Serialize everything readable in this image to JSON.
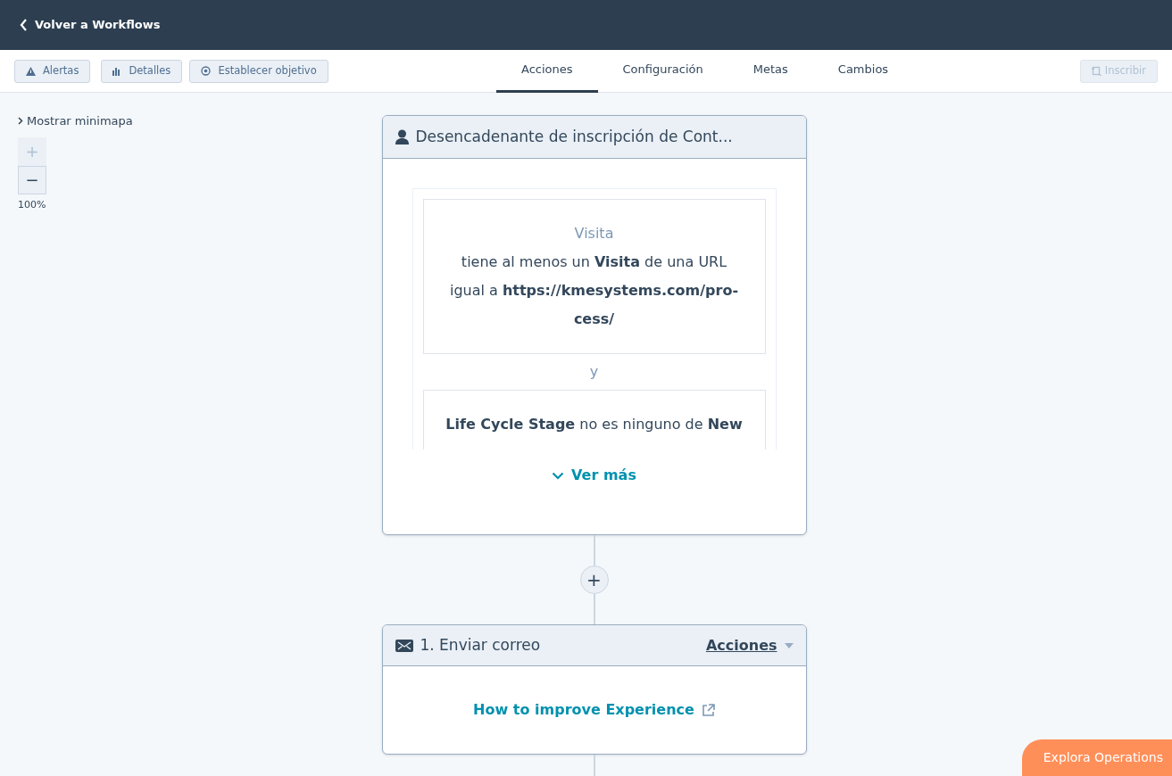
{
  "top_bar": {
    "back_label": "Volver a Workflows"
  },
  "toolbar": {
    "buttons": [
      {
        "label": "Alertas",
        "kind": "alert"
      },
      {
        "label": "Detalles",
        "kind": "chart"
      },
      {
        "label": "Establecer objetivo",
        "kind": "target"
      }
    ]
  },
  "tabs": [
    {
      "label": "Acciones",
      "selected": true
    },
    {
      "label": "Configuración",
      "selected": false
    },
    {
      "label": "Metas",
      "selected": false
    },
    {
      "label": "Cambios",
      "selected": false
    }
  ],
  "enroll_button": {
    "label": "Inscribir",
    "disabled": true
  },
  "canvas": {
    "minimap_toggle": "Mostrar minimapa",
    "zoom_buttons": [
      {
        "symbol": "+",
        "disabled": true
      },
      {
        "symbol": "−",
        "disabled": false
      }
    ],
    "zoom_level": "100%"
  },
  "trigger_card": {
    "title": "Desencadenante de inscripción de Cont...",
    "conditions": [
      {
        "heading": "Visita",
        "text": "tiene al menos un **Visita** de una URL igual a **https://kmesystems.com/pro-cess/**"
      },
      {
        "text": "**Life Cycle Stage** no es ninguno de **New**"
      }
    ],
    "joiner": "y",
    "see_more": "Ver más"
  },
  "add_button": {
    "symbol": "+"
  },
  "action_card": {
    "title": "1. Enviar correo",
    "menu_label": "Acciones",
    "link": "How to improve Experience"
  },
  "promo_button": {
    "label": "Explora Operations"
  }
}
